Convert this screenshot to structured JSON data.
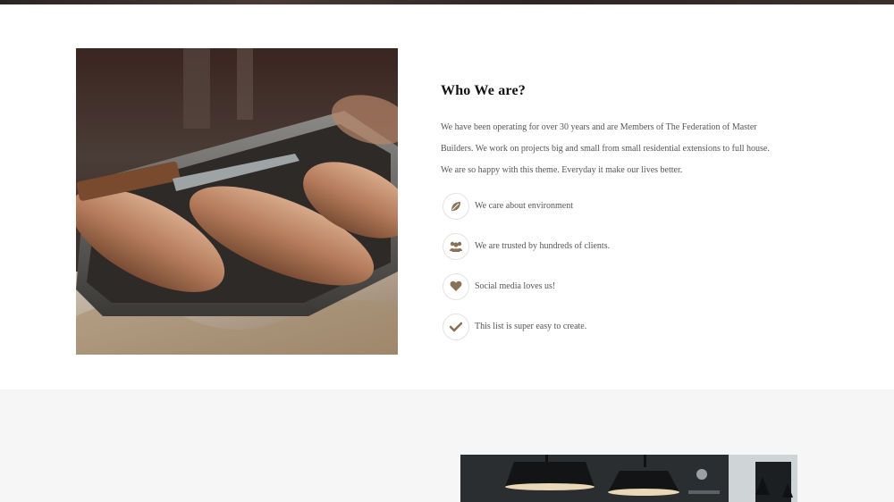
{
  "about": {
    "title": "Who We are?",
    "description": "We have been operating for over 30 years and are Members of The Federation of Master Builders. We work on projects big and small from small residential extensions to full house. We are so happy with this theme. Everyday it make our lives better.",
    "features": [
      {
        "icon": "leaf-icon",
        "label": "We care about environment"
      },
      {
        "icon": "users-icon",
        "label": "We are trusted by hundreds of clients."
      },
      {
        "icon": "heart-icon",
        "label": "Social media loves us!"
      },
      {
        "icon": "check-icon",
        "label": "This list is super easy to create."
      }
    ]
  },
  "colors": {
    "accent": "#8a7256",
    "title": "#111111",
    "body_text": "#555555",
    "section_bg": "#f7f6f6"
  }
}
